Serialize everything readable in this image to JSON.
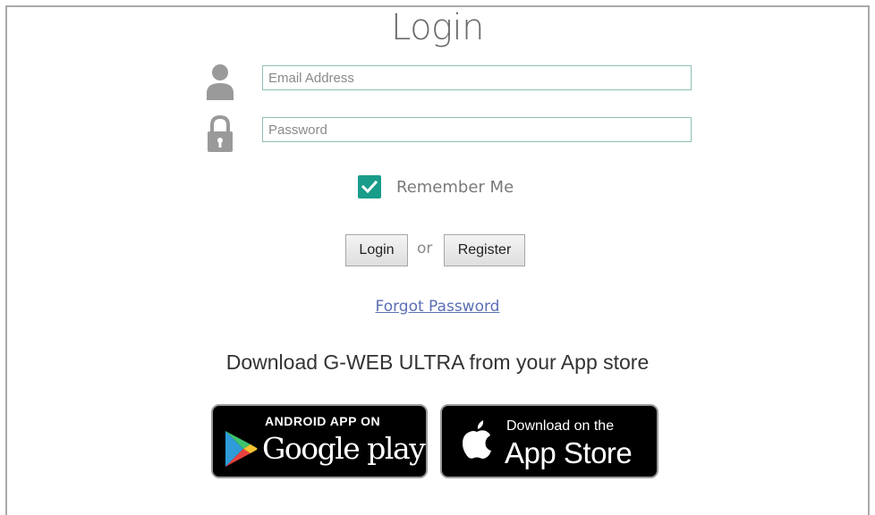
{
  "page": {
    "title": "Login"
  },
  "form": {
    "email_placeholder": "Email Address",
    "password_placeholder": "Password",
    "remember_label": "Remember Me",
    "remember_checked": true,
    "login_label": "Login",
    "or_text": "or",
    "register_label": "Register",
    "forgot_label": "Forgot Password"
  },
  "download": {
    "heading": "Download G-WEB ULTRA from your App store",
    "google": {
      "small": "ANDROID APP ON",
      "big": "Google play"
    },
    "apple": {
      "small": "Download on the",
      "big": "App Store"
    }
  },
  "icons": {
    "user": "user-icon",
    "lock": "lock-icon",
    "check": "check-icon",
    "play": "google-play-icon",
    "apple": "apple-icon"
  },
  "colors": {
    "accent": "#1a9c8a",
    "field_border": "#8fbfb6",
    "link": "#5b6fb5",
    "icon_gray": "#9a9a9a"
  }
}
